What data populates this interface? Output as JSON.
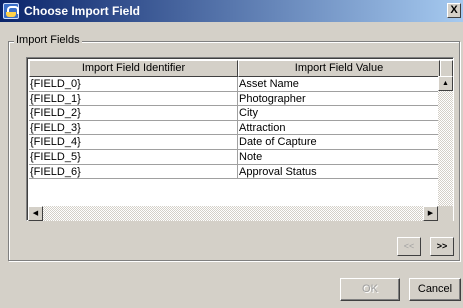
{
  "window": {
    "title": "Choose Import Field",
    "close_glyph": "X"
  },
  "group": {
    "label": "Import Fields"
  },
  "table": {
    "columns": [
      "Import Field Identifier",
      "Import Field Value"
    ],
    "rows": [
      {
        "id": "{FIELD_0}",
        "value": "Asset Name"
      },
      {
        "id": "{FIELD_1}",
        "value": "Photographer"
      },
      {
        "id": "{FIELD_2}",
        "value": "City"
      },
      {
        "id": "{FIELD_3}",
        "value": "Attraction"
      },
      {
        "id": "{FIELD_4}",
        "value": "Date of Capture"
      },
      {
        "id": "{FIELD_5}",
        "value": "Note"
      },
      {
        "id": "{FIELD_6}",
        "value": "Approval Status"
      }
    ]
  },
  "paging": {
    "prev_label": "<<",
    "next_label": ">>"
  },
  "buttons": {
    "ok_label": "OK",
    "cancel_label": "Cancel"
  },
  "scroll": {
    "up": "▲",
    "down": "▼",
    "left": "◀",
    "right": "▶"
  }
}
